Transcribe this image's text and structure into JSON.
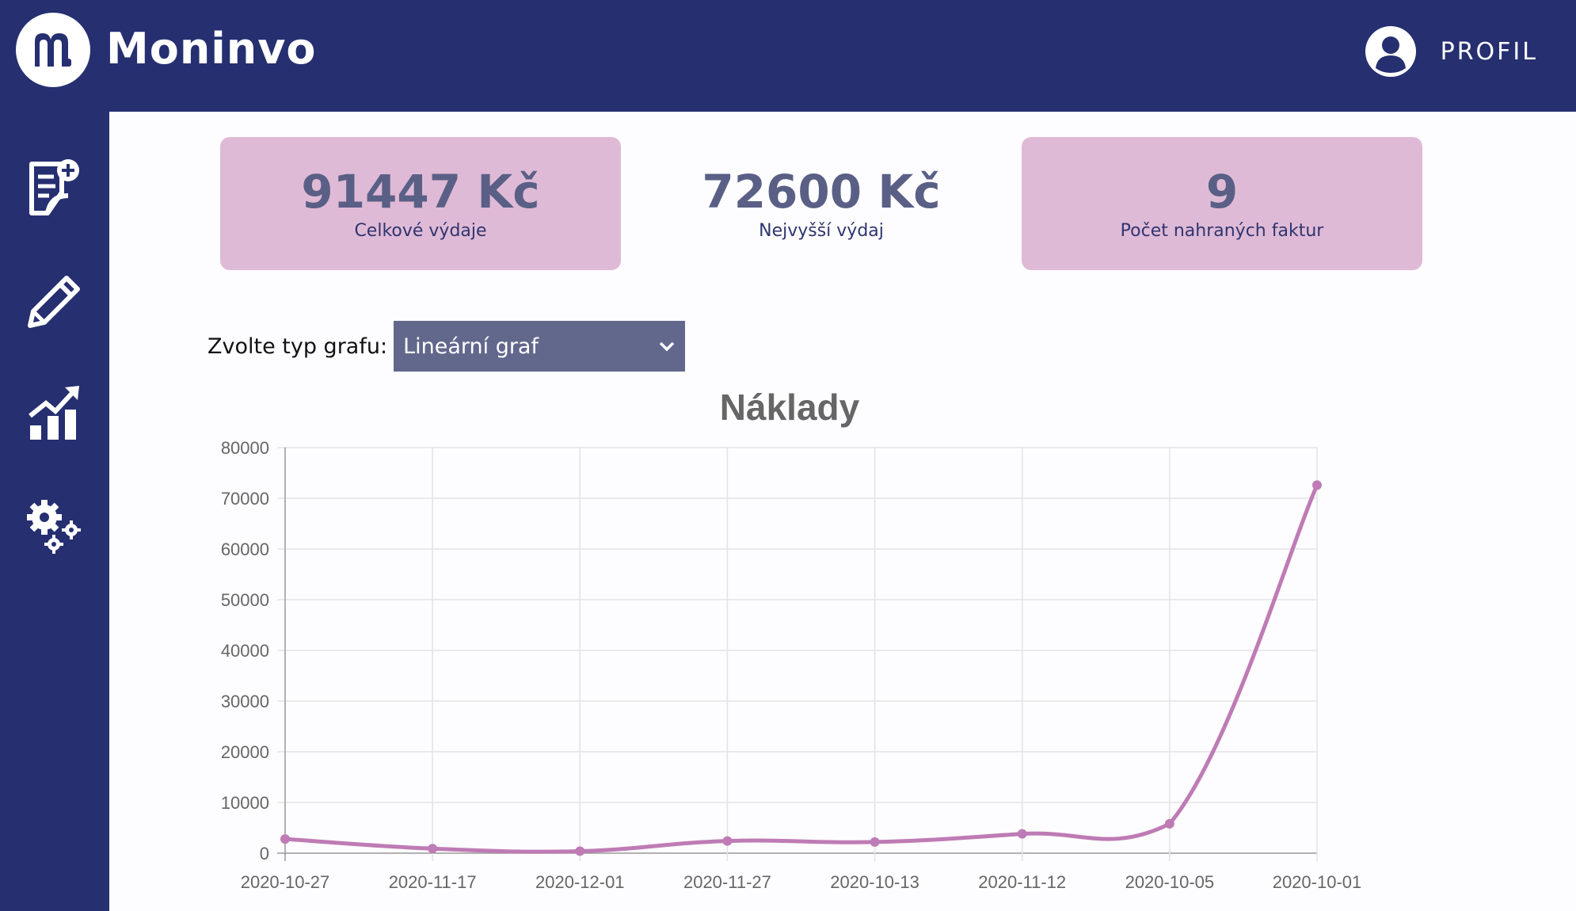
{
  "app": {
    "name": "Moninvo",
    "profile_label": "PROFIL"
  },
  "sidebar": {
    "items": [
      {
        "icon": "add-invoice-icon"
      },
      {
        "icon": "pencil-icon"
      },
      {
        "icon": "chart-growth-icon"
      },
      {
        "icon": "settings-gears-icon"
      }
    ]
  },
  "stats": [
    {
      "value": "91447 Kč",
      "label": "Celkové výdaje"
    },
    {
      "value": "72600 Kč",
      "label": "Nejvyšší výdaj"
    },
    {
      "value": "9",
      "label": "Počet nahraných faktur"
    }
  ],
  "chart_selector": {
    "label": "Zvolte typ grafu:",
    "selected": "Lineární graf"
  },
  "colors": {
    "brand": "#262f70",
    "card_pink": "#dfbad6",
    "line": "#be7bb5",
    "select_bg": "#62678c"
  },
  "chart_data": {
    "type": "line",
    "title": "Náklady",
    "categories": [
      "2020-10-27",
      "2020-11-17",
      "2020-12-01",
      "2020-11-27",
      "2020-10-13",
      "2020-11-12",
      "2020-10-05",
      "2020-10-01"
    ],
    "values": [
      2800,
      900,
      400,
      2400,
      2200,
      3800,
      5800,
      72600
    ],
    "ylim": [
      0,
      80000
    ],
    "yticks": [
      0,
      10000,
      20000,
      30000,
      40000,
      50000,
      60000,
      70000,
      80000
    ],
    "grid": true
  }
}
